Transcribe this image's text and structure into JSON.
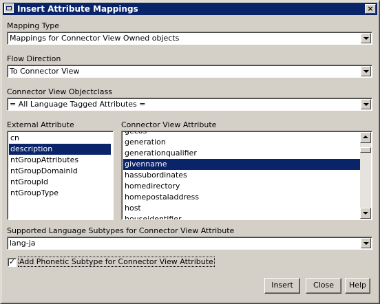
{
  "window": {
    "title": "Insert Attribute Mappings",
    "close_glyph": "×"
  },
  "mapping_type": {
    "label": "Mapping Type",
    "value": "Mappings for Connector View Owned objects"
  },
  "flow_direction": {
    "label": "Flow Direction",
    "value": "To Connector View"
  },
  "objectclass": {
    "label": "Connector View Objectclass",
    "value": "= All Language Tagged Attributes ="
  },
  "external": {
    "label": "External Attribute",
    "items": [
      "cn",
      "description",
      "ntGroupAttributes",
      "ntGroupDomainId",
      "ntGroupId",
      "ntGroupType"
    ]
  },
  "connector": {
    "label": "Connector View Attribute",
    "items": [
      "gecos",
      "generation",
      "generationqualifier",
      "givenname",
      "hassubordinates",
      "homedirectory",
      "homepostaladdress",
      "host",
      "houseidentifier"
    ]
  },
  "language": {
    "label": "Supported Language Subtypes for Connector View Attribute",
    "value": "lang-ja"
  },
  "phonetic": {
    "label": "Add Phonetic Subtype for Connector View Attribute",
    "checked": true,
    "check_glyph": "✓"
  },
  "buttons": {
    "insert": "Insert",
    "close": "Close",
    "help": "Help"
  }
}
